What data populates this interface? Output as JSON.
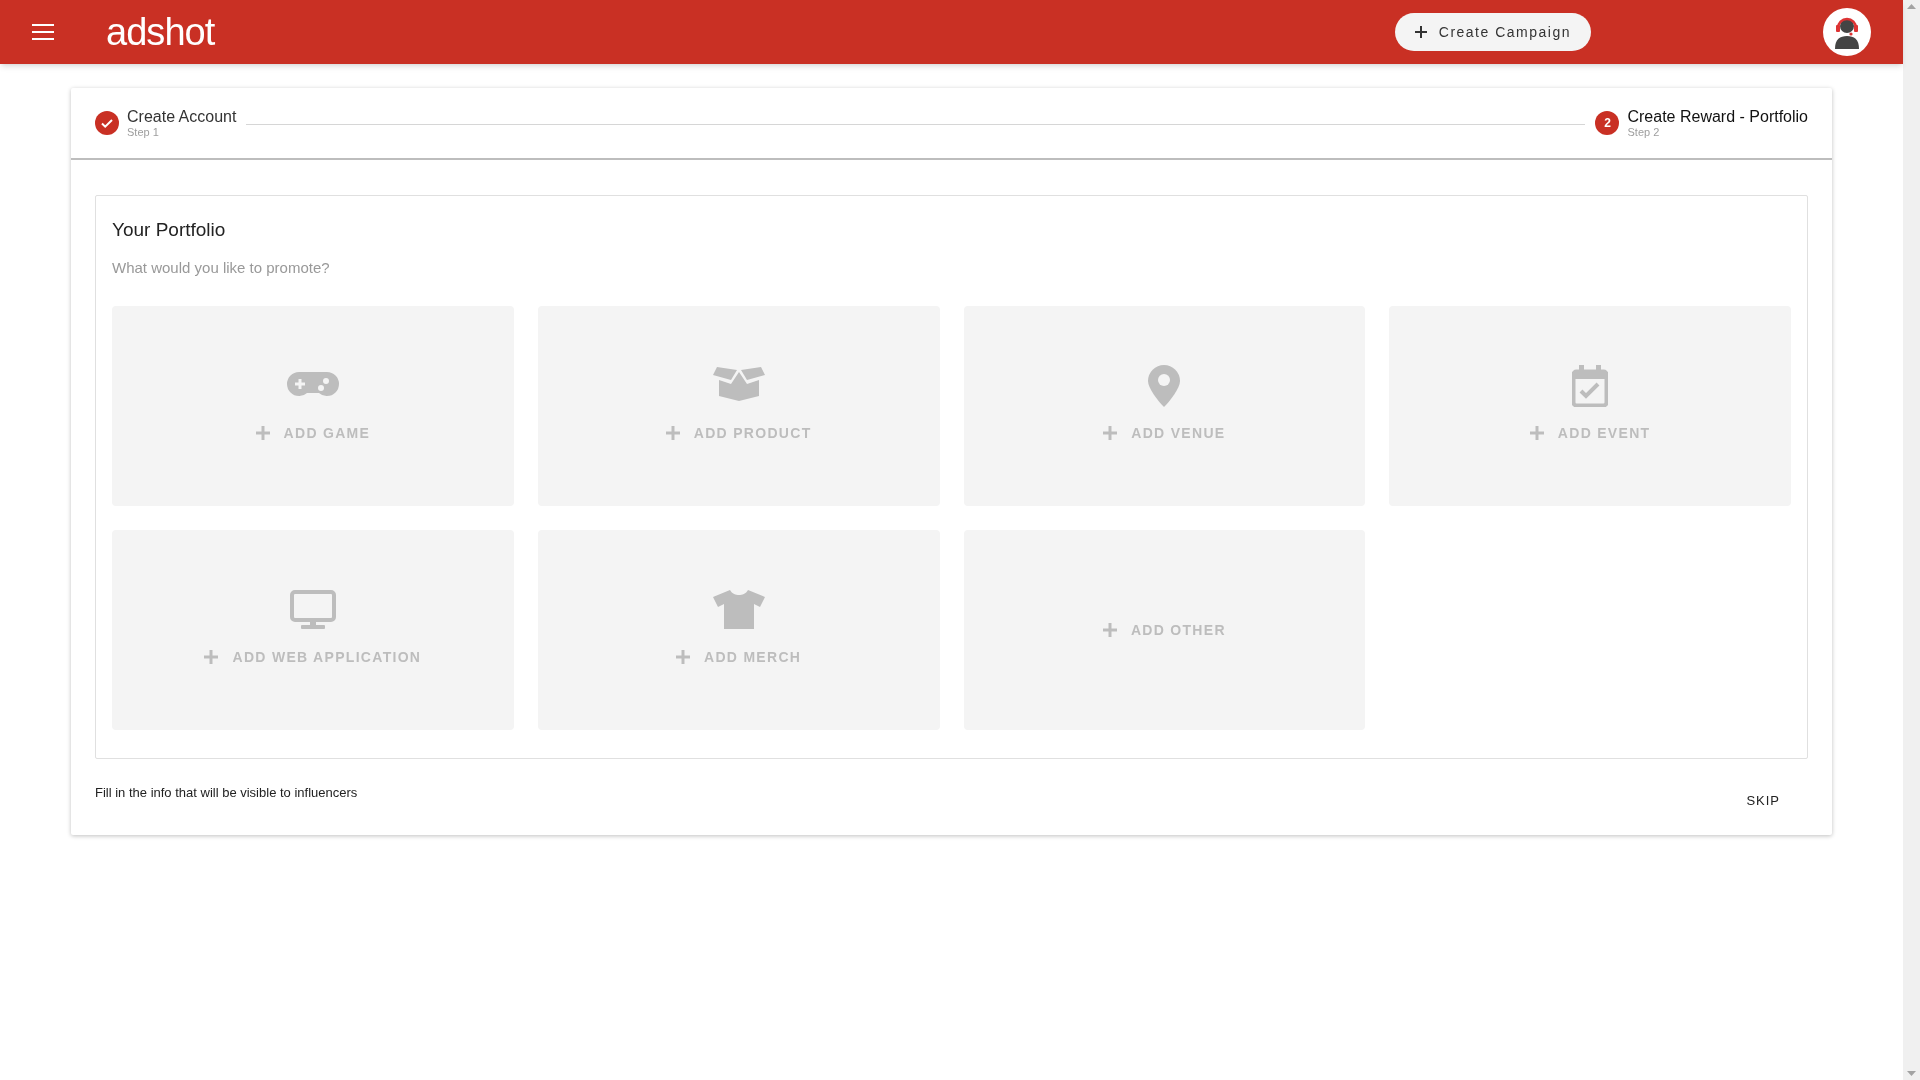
{
  "header": {
    "logo": "adshot",
    "create_button": "Create Campaign"
  },
  "steps": [
    {
      "title": "Create Account",
      "subtitle": "Step 1",
      "done": true
    },
    {
      "title": "Create Reward - Portfolio",
      "subtitle": "Step 2",
      "number": "2",
      "done": false
    }
  ],
  "portfolio": {
    "title": "Your Portfolio",
    "subtitle": "What would you like to promote?",
    "tiles": [
      {
        "kind": "game",
        "label": "ADD GAME"
      },
      {
        "kind": "product",
        "label": "ADD PRODUCT"
      },
      {
        "kind": "venue",
        "label": "ADD VENUE"
      },
      {
        "kind": "event",
        "label": "ADD EVENT"
      },
      {
        "kind": "webapp",
        "label": "ADD WEB APPLICATION"
      },
      {
        "kind": "merch",
        "label": "ADD MERCH"
      },
      {
        "kind": "other",
        "label": "ADD OTHER"
      }
    ]
  },
  "footer": {
    "hint": "Fill in the info that will be visible to influencers",
    "skip": "SKIP"
  }
}
